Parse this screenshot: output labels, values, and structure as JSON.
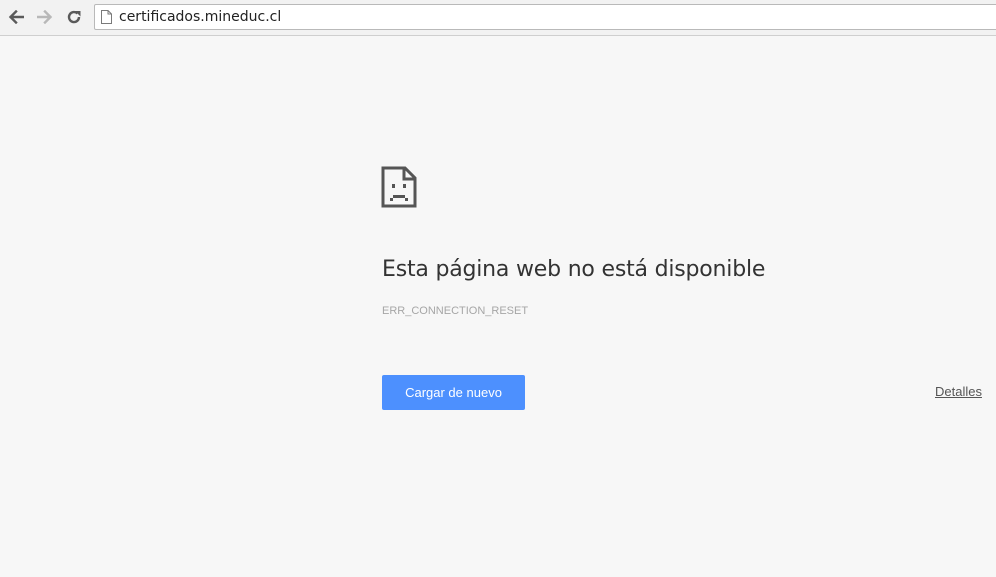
{
  "browser": {
    "url": "certificados.mineduc.cl",
    "back_icon": "arrow-left-icon",
    "forward_icon": "arrow-right-icon",
    "reload_icon": "reload-icon",
    "page_icon": "page-icon"
  },
  "error": {
    "icon": "sad-page-icon",
    "title": "Esta página web no está disponible",
    "code": "ERR_CONNECTION_RESET",
    "reload_label": "Cargar de nuevo",
    "details_label": "Detalles"
  },
  "colors": {
    "page_background": "#f7f7f7",
    "button_blue": "#4d90fe",
    "title_text": "#333333",
    "code_text": "#a6a6a6"
  }
}
